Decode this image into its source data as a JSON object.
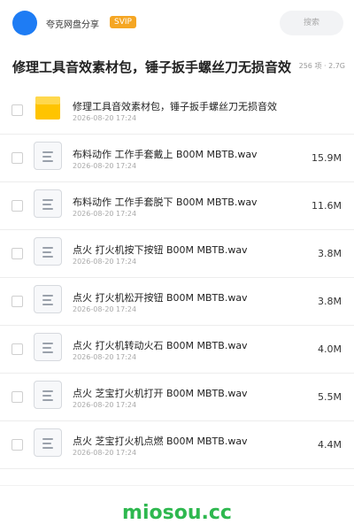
{
  "header": {
    "site_name": "夸克网盘分享",
    "badge": "SVIP",
    "search_placeholder": "搜索",
    "avatar_color": "#1e7cf4",
    "badge_color": "#f5a623"
  },
  "title_bar": {
    "title": "修理工具音效素材包，锤子扳手螺丝刀无损音效",
    "meta": "256 项 · 2.7G"
  },
  "files": [
    {
      "icon": "folder-icon",
      "name": "修理工具音效素材包，锤子扳手螺丝刀无损音效",
      "date": "2026-08-20 17:24",
      "size": ""
    },
    {
      "icon": "file-icon",
      "name": "布料动作 工作手套戴上 B00M MBTB.wav",
      "date": "2026-08-20 17:24",
      "size": "15.9M"
    },
    {
      "icon": "file-icon",
      "name": "布料动作 工作手套脱下 B00M MBTB.wav",
      "date": "2026-08-20 17:24",
      "size": "11.6M"
    },
    {
      "icon": "file-icon",
      "name": "点火 打火机按下按钮 B00M MBTB.wav",
      "date": "2026-08-20 17:24",
      "size": "3.8M"
    },
    {
      "icon": "file-icon",
      "name": "点火 打火机松开按钮 B00M MBTB.wav",
      "date": "2026-08-20 17:24",
      "size": "3.8M"
    },
    {
      "icon": "file-icon",
      "name": "点火 打火机转动火石 B00M MBTB.wav",
      "date": "2026-08-20 17:24",
      "size": "4.0M"
    },
    {
      "icon": "file-icon",
      "name": "点火 芝宝打火机打开 B00M MBTB.wav",
      "date": "2026-08-20 17:24",
      "size": "5.5M"
    },
    {
      "icon": "file-icon",
      "name": "点火 芝宝打火机点燃 B00M MBTB.wav",
      "date": "2026-08-20 17:24",
      "size": "4.4M"
    }
  ],
  "footer": {
    "brand": "miosou.cc",
    "brand_color": "#2eb84f"
  }
}
